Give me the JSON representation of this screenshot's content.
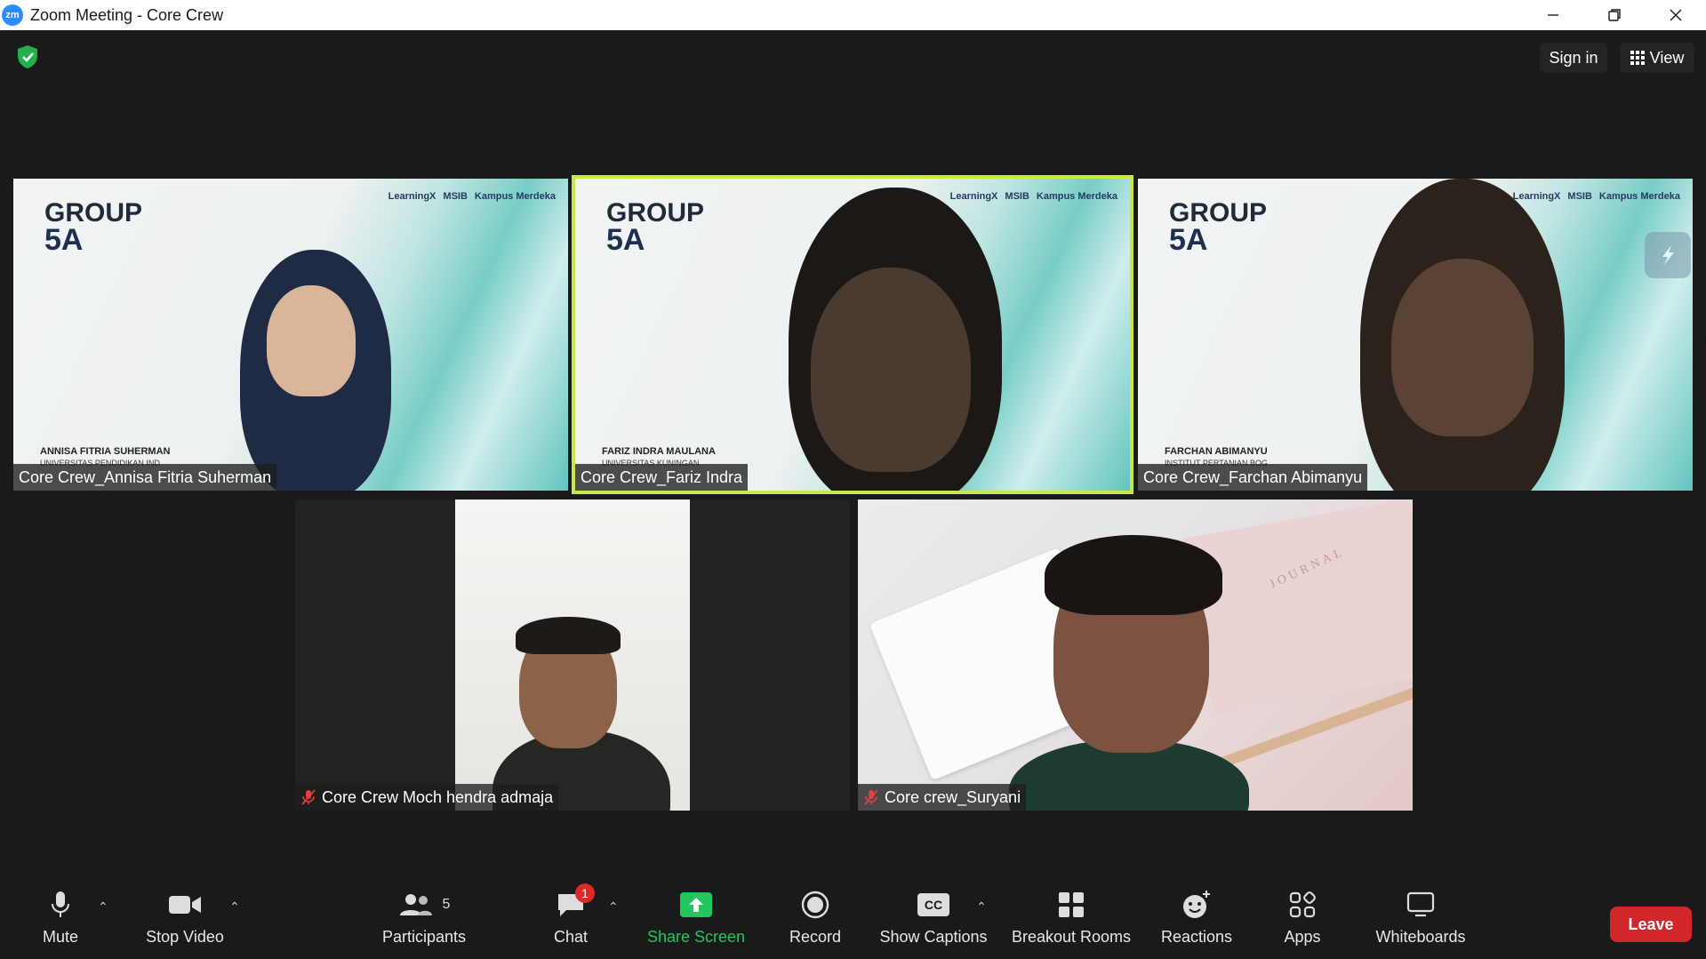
{
  "window": {
    "logo_text": "zm",
    "title": "Zoom Meeting - Core Crew"
  },
  "header": {
    "sign_in_label": "Sign in",
    "view_label": "View"
  },
  "tiles": [
    {
      "name": "Core Crew_Annisa Fitria Suherman",
      "group_line1": "GROUP",
      "group_line2": "5A",
      "caption_name": "ANNISA FITRIA SUHERMAN",
      "caption_univ": "UNIVERSITAS PENDIDIKAN IND",
      "logos": [
        "LearningX",
        "MSIB",
        "Kampus Merdeka"
      ],
      "muted": false,
      "active_speaker": false
    },
    {
      "name": "Core Crew_Fariz Indra",
      "group_line1": "GROUP",
      "group_line2": "5A",
      "caption_name": "FARIZ INDRA MAULANA",
      "caption_univ": "UNIVERSITAS KUNINGAN",
      "logos": [
        "LearningX",
        "MSIB",
        "Kampus Merdeka"
      ],
      "muted": false,
      "active_speaker": true
    },
    {
      "name": "Core Crew_Farchan Abimanyu",
      "group_line1": "GROUP",
      "group_line2": "5A",
      "caption_name": "FARCHAN ABIMANYU",
      "caption_univ": "INSTITUT PERTANIAN BOG",
      "logos": [
        "LearningX",
        "MSIB",
        "Kampus Merdeka"
      ],
      "muted": false,
      "active_speaker": false
    },
    {
      "name": "Core Crew Moch hendra admaja",
      "muted": true,
      "active_speaker": false
    },
    {
      "name": "Core crew_Suryani",
      "background_text": "JOURNAL",
      "muted": true,
      "active_speaker": false
    }
  ],
  "toolbar": {
    "mute_label": "Mute",
    "stop_video_label": "Stop Video",
    "participants_label": "Participants",
    "participants_count": "5",
    "chat_label": "Chat",
    "chat_badge": "1",
    "share_screen_label": "Share Screen",
    "record_label": "Record",
    "show_captions_label": "Show Captions",
    "captions_icon_text": "CC",
    "breakout_rooms_label": "Breakout Rooms",
    "reactions_label": "Reactions",
    "apps_label": "Apps",
    "whiteboards_label": "Whiteboards",
    "leave_label": "Leave"
  },
  "colors": {
    "share_green": "#22c55e",
    "leave_red": "#d1272c",
    "active_speaker_outline": "#c8e84a",
    "badge_red": "#e02828",
    "zoom_blue": "#2d8cff"
  },
  "icons": [
    "zoom-logo",
    "shield-check-icon",
    "grid-icon",
    "microphone-icon",
    "video-camera-icon",
    "participants-icon",
    "chat-icon",
    "share-arrow-icon",
    "record-icon",
    "cc-icon",
    "breakout-grid-icon",
    "reaction-icon",
    "apps-icon",
    "whiteboard-icon",
    "mic-muted-icon"
  ]
}
